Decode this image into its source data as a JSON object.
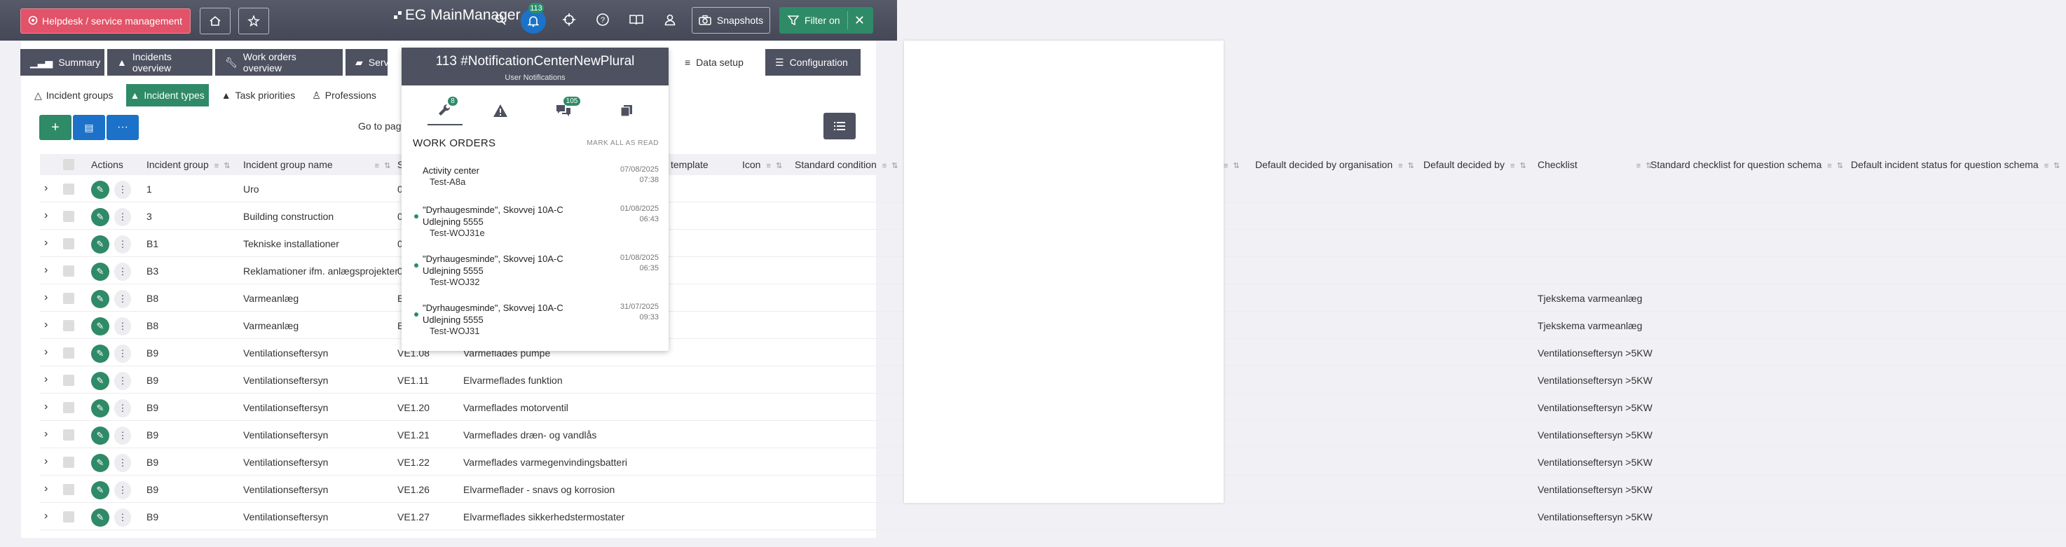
{
  "topbar": {
    "helpdesk_label": "Helpdesk / service management",
    "logo_text": "EG MainManager",
    "bell_count": "113",
    "snapshots_label": "Snapshots",
    "filter_label": "Filter on"
  },
  "tabs": [
    "Summary",
    "Incidents overview",
    "Work orders overview",
    "Serv",
    "Data setup",
    "Configuration"
  ],
  "subtabs": [
    "Incident groups",
    "Incident types",
    "Task priorities",
    "Professions"
  ],
  "toolbar": {
    "goto_label": "Go to page"
  },
  "table": {
    "headers": {
      "actions": "Actions",
      "incident_group": "Incident group",
      "incident_group_name": "Incident group name",
      "s": "S",
      "template": "template",
      "icon": "Icon",
      "standard_condition": "Standard condition",
      "default_by_org": "Default decided by organisation",
      "default_by": "Default decided by",
      "checklist": "Checklist",
      "std_checklist": "Standard checklist for question schema",
      "default_status": "Default incident status for question schema"
    },
    "rows": [
      {
        "group": "1",
        "name": "Uro",
        "code": "0",
        "desc": "",
        "checklist": ""
      },
      {
        "group": "3",
        "name": "Building construction",
        "code": "0",
        "desc": "",
        "checklist": ""
      },
      {
        "group": "B1",
        "name": "Tekniske installationer",
        "code": "0",
        "desc": "",
        "checklist": ""
      },
      {
        "group": "B3",
        "name": "Reklamationer ifm. anlægsprojekter",
        "code": "0",
        "desc": "",
        "checklist": ""
      },
      {
        "group": "B8",
        "name": "Varmeanlæg",
        "code": "B",
        "desc": "",
        "checklist": "Tjekskema varmeanlæg"
      },
      {
        "group": "B8",
        "name": "Varmeanlæg",
        "code": "B",
        "desc": "",
        "checklist": "Tjekskema varmeanlæg"
      },
      {
        "group": "B9",
        "name": "Ventilationseftersyn",
        "code": "VE1.08",
        "desc": "Varmeflades pumpe",
        "checklist": "Ventilationseftersyn >5KW"
      },
      {
        "group": "B9",
        "name": "Ventilationseftersyn",
        "code": "VE1.11",
        "desc": "Elvarmeflades funktion",
        "checklist": "Ventilationseftersyn >5KW"
      },
      {
        "group": "B9",
        "name": "Ventilationseftersyn",
        "code": "VE1.20",
        "desc": "Varmeflades motorventil",
        "checklist": "Ventilationseftersyn >5KW"
      },
      {
        "group": "B9",
        "name": "Ventilationseftersyn",
        "code": "VE1.21",
        "desc": "Varmeflades dræn- og vandlås",
        "checklist": "Ventilationseftersyn >5KW"
      },
      {
        "group": "B9",
        "name": "Ventilationseftersyn",
        "code": "VE1.22",
        "desc": "Varmeflades varmegenvindingsbatteri",
        "checklist": "Ventilationseftersyn >5KW"
      },
      {
        "group": "B9",
        "name": "Ventilationseftersyn",
        "code": "VE1.26",
        "desc": "Elvarmeflader - snavs og korrosion",
        "checklist": "Ventilationseftersyn >5KW"
      },
      {
        "group": "B9",
        "name": "Ventilationseftersyn",
        "code": "VE1.27",
        "desc": "Elvarmeflades sikkerhedstermostater",
        "checklist": "Ventilationseftersyn >5KW"
      }
    ]
  },
  "notifications": {
    "title": "113 #NotificationCenterNewPlural",
    "subtitle": "User Notifications",
    "badges": {
      "work_orders": "8",
      "messages": "105"
    },
    "section_title": "WORK ORDERS",
    "mark_all": "MARK ALL AS READ",
    "items": [
      {
        "title": "Activity center",
        "sub": "Test-A8a",
        "date": "07/08/2025",
        "time": "07:38",
        "unread": false
      },
      {
        "title": "\"Dyrhaugesminde\", Skovvej 10A-C Udlejning 5555",
        "sub": "Test-WOJ31e",
        "date": "01/08/2025",
        "time": "06:43",
        "unread": true
      },
      {
        "title": "\"Dyrhaugesminde\", Skovvej 10A-C Udlejning 5555",
        "sub": "Test-WOJ32",
        "date": "01/08/2025",
        "time": "06:35",
        "unread": true
      },
      {
        "title": "\"Dyrhaugesminde\", Skovvej 10A-C Udlejning 5555",
        "sub": "Test-WOJ31",
        "date": "31/07/2025",
        "time": "09:33",
        "unread": true
      }
    ]
  },
  "colors": {
    "accent": "#2f8a68",
    "dark": "#4d5160",
    "helpdesk": "#e25268",
    "bell": "#1b72c8"
  }
}
